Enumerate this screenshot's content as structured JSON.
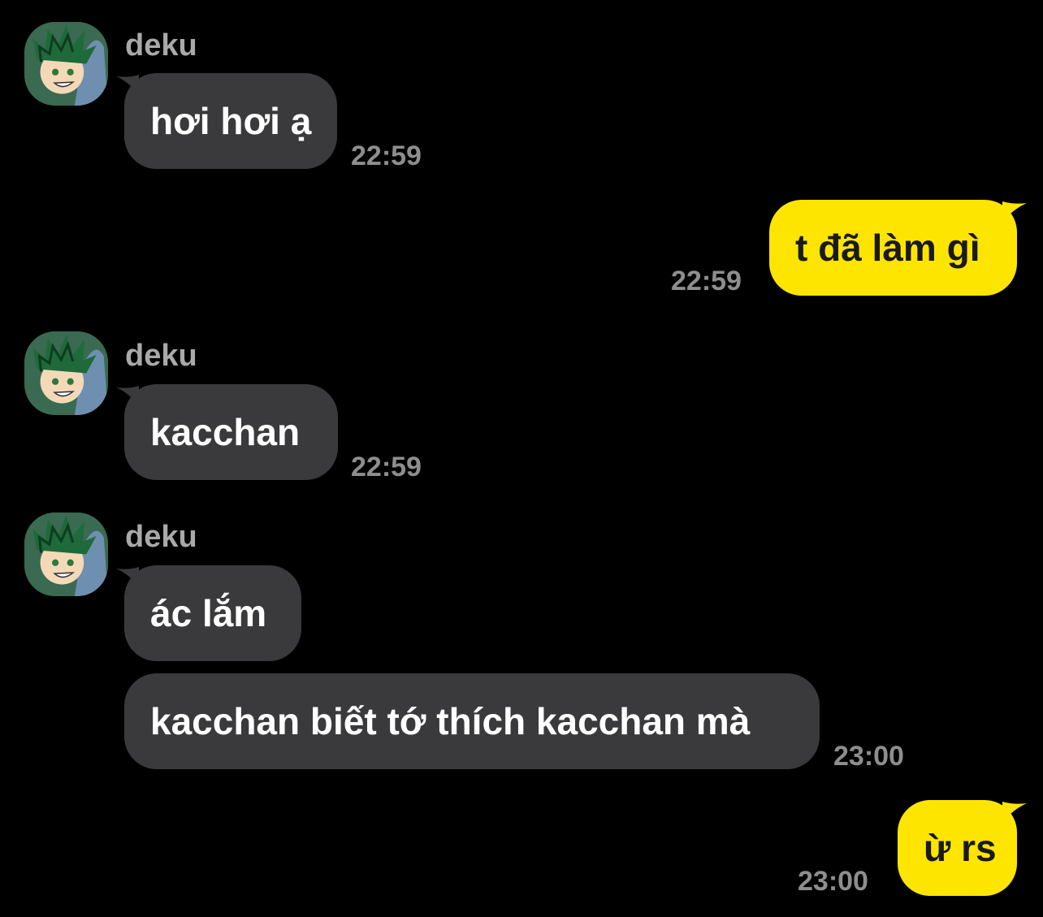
{
  "messages": [
    {
      "sender": "deku",
      "text": "hơi hơi ạ",
      "time": "22:59"
    },
    {
      "text": "t đã làm gì",
      "time": "22:59"
    },
    {
      "sender": "deku",
      "text": "kacchan",
      "time": "22:59"
    },
    {
      "sender": "deku",
      "text": "ác lắm"
    },
    {
      "text": "kacchan biết tớ thích kacchan mà",
      "time": "23:00"
    },
    {
      "text": "ừ rs",
      "time": "23:00"
    }
  ],
  "colors": {
    "background": "#000000",
    "incoming_bubble": "#3a3a3c",
    "outgoing_bubble": "#fee500",
    "timestamp": "#8e8e8e",
    "sender_name": "#a9a9a9"
  },
  "avatar_icon": "deku-avatar-icon"
}
